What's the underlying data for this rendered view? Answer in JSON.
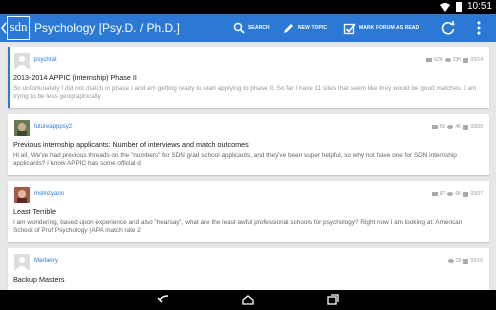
{
  "status_bar": {
    "time": "10:51"
  },
  "app_bar": {
    "logo_text": "sdn",
    "title": "Psychology [Psy.D. / Ph.D.]",
    "actions": {
      "search": "SEARCH",
      "new_topic": "NEW TOPIC",
      "mark_read": "MARK FORUM AS READ"
    }
  },
  "threads": [
    {
      "author": "psychrat",
      "replies": "624",
      "views": "33K",
      "date": "03/14",
      "title": "2013-2014 APPIC (internship) Phase II",
      "snippet": "So unfortunately I did not match in phase I and am getting ready to start applying to phase II. So far I have 11 sites that seem like they would be good matches. I am trying to be less geographically",
      "unread": true,
      "avatar_icon": "default-avatar-icon"
    },
    {
      "author": "futureapppsy2",
      "replies": "65",
      "views": "4K",
      "date": "03/05",
      "title": "Previous internship applicants: Number of interviews and match outcomes",
      "snippet": "Hi all,  We've had previous threads on the \"numbers\" for SDN grad school applicants, and they've been super helpful, so why not have one for SDN internship applicants? I know APPIC has some official d",
      "unread": false,
      "avatar_icon": "photo-avatar-icon"
    },
    {
      "author": "mslinzyann",
      "replies": "87",
      "views": "6K",
      "date": "03/07",
      "title": "Least Terrible",
      "snippet": "I am wondering, based upon experience and also \"hearsay\", what are the least awful professional schools for psychology? Right now I am looking at:  American School of Prof Psychology (APA match rate 2",
      "unread": false,
      "avatar_icon": "photo-avatar-icon"
    },
    {
      "author": "Marberry",
      "replies": "39",
      "views": "",
      "date": "03/15",
      "title": "Backup Masters",
      "snippet": "",
      "unread": false,
      "avatar_icon": "default-avatar-icon"
    }
  ],
  "colors": {
    "accent": "#2b78d5",
    "background": "#e6e6e6"
  },
  "nav": {
    "back": "back-icon",
    "home": "home-icon",
    "recents": "recents-icon"
  }
}
